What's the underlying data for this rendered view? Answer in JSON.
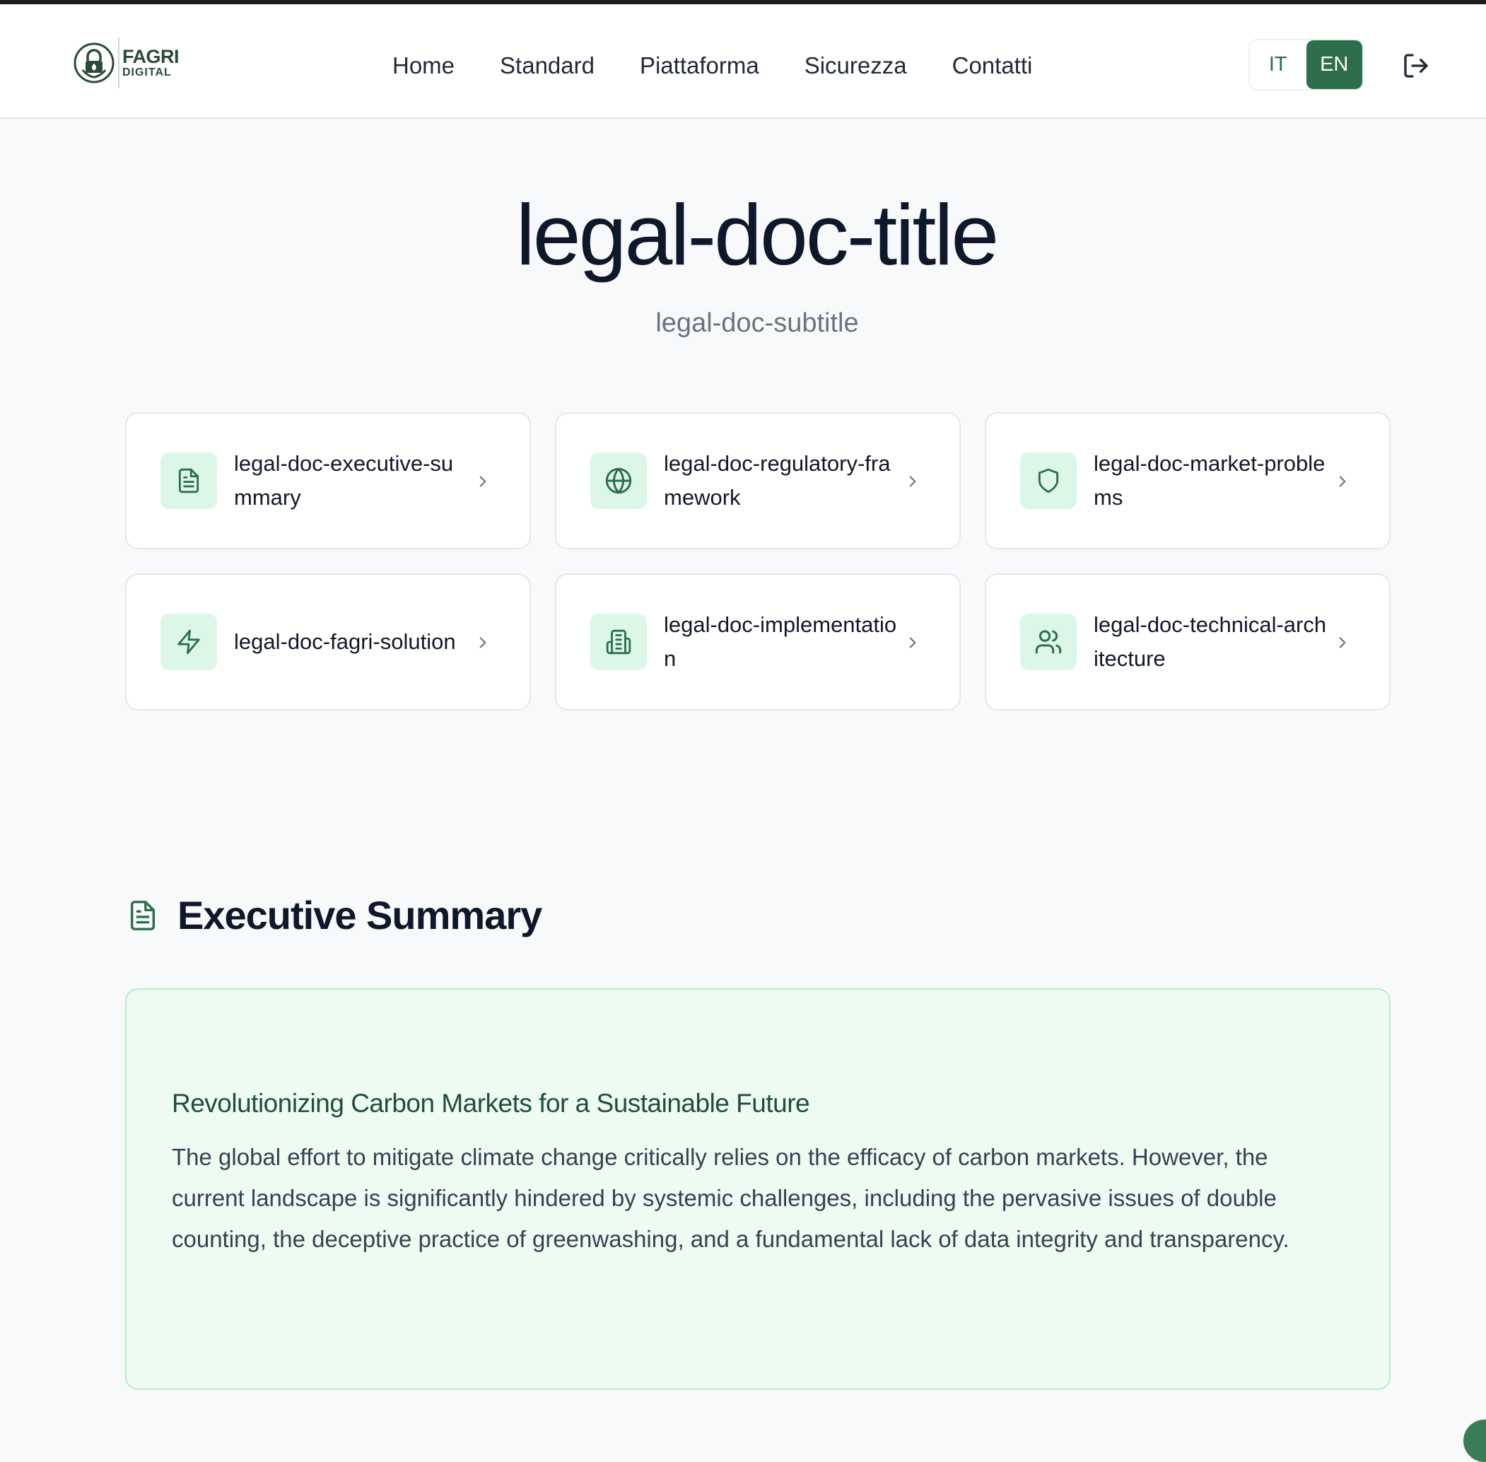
{
  "brand": {
    "line1": "FAGRI",
    "line2": "DIGITAL",
    "logo_icon": "padlock-leaf-logo-icon"
  },
  "nav": {
    "items": [
      {
        "label": "Home"
      },
      {
        "label": "Standard"
      },
      {
        "label": "Piattaforma"
      },
      {
        "label": "Sicurezza"
      },
      {
        "label": "Contatti"
      }
    ]
  },
  "language": {
    "options": [
      "IT",
      "EN"
    ],
    "selected": "EN"
  },
  "logout": {
    "icon": "logout-icon"
  },
  "hero": {
    "title": "legal-doc-title",
    "subtitle": "legal-doc-subtitle"
  },
  "cards": [
    {
      "label": "legal-doc-executive-summary",
      "icon": "document-icon"
    },
    {
      "label": "legal-doc-regulatory-framework",
      "icon": "globe-icon"
    },
    {
      "label": "legal-doc-market-problems",
      "icon": "shield-icon"
    },
    {
      "label": "legal-doc-fagri-solution",
      "icon": "lightning-icon"
    },
    {
      "label": "legal-doc-implementation",
      "icon": "building-icon"
    },
    {
      "label": "legal-doc-technical-architecture",
      "icon": "users-icon"
    }
  ],
  "section": {
    "title": "Executive Summary",
    "icon": "document-icon",
    "heading": "Revolutionizing Carbon Markets for a Sustainable Future",
    "body": "The global effort to mitigate climate change critically relies on the efficacy of carbon markets. However, the current landscape is significantly hindered by systemic challenges, including the pervasive issues of double counting, the deceptive practice of greenwashing, and a fundamental lack of data integrity and transparency."
  },
  "colors": {
    "accent": "#2f6e4b",
    "accent_light": "#dcf7e7",
    "summary_bg": "#edfbf3"
  }
}
